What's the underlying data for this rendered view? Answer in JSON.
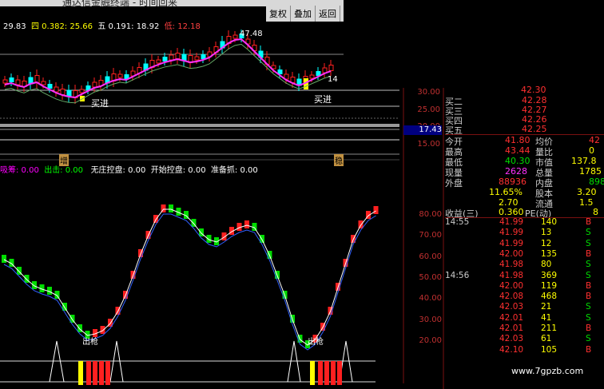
{
  "window": {
    "title": "通达信金融终端 - 时间回来",
    "buttons": [
      "复权",
      "叠加",
      "返回"
    ]
  },
  "price_panel": {
    "legend": [
      {
        "text": "29.83",
        "color": "#ffffff"
      },
      {
        "text": "四 0.382: 25.66",
        "color": "#ffff00"
      },
      {
        "text": "五 0.191: 18.92",
        "color": "#ffffff"
      },
      {
        "text": "低: 12.18",
        "color": "#ff4040"
      }
    ],
    "peak_label": "47.48",
    "low_label": "14",
    "buy_label": "买进",
    "axis": [
      "30.00",
      "25.00",
      "20.00",
      "15.00"
    ],
    "current_price": "17.43",
    "left_marker": "增",
    "right_marker": "稳"
  },
  "indicator_panel": {
    "legend": [
      {
        "text": "吸筹: 0.00",
        "color": "#ff00ff"
      },
      {
        "text": "出击: 0.00",
        "color": "#00ff00"
      },
      {
        "text": "无庄控盘: 0.00",
        "color": "#ffffff"
      },
      {
        "text": "开始控盘: 0.00",
        "color": "#ffffff"
      },
      {
        "text": "准备抓: 0.00",
        "color": "#ffffff"
      }
    ],
    "axis": [
      "80.00",
      "70.00",
      "60.00",
      "50.00",
      "40.00",
      "30.00",
      "20.00"
    ],
    "signal_label": "出枪"
  },
  "quote": {
    "bids": [
      {
        "label": "买二",
        "price": "42.28"
      },
      {
        "label": "买三",
        "price": "42.27"
      },
      {
        "label": "买四",
        "price": "42.26"
      },
      {
        "label": "买五",
        "price": "42.25"
      }
    ],
    "top_price": "42.30",
    "stats": [
      {
        "l1": "今开",
        "v1": "41.80",
        "l2": "均价",
        "v2": "42"
      },
      {
        "l1": "最高",
        "v1": "43.44",
        "l2": "量比",
        "v2": "0"
      },
      {
        "l1": "最低",
        "v1": "40.30",
        "l2": "市值",
        "v2": "137.8"
      },
      {
        "l1": "现量",
        "v1": "2628",
        "l2": "总量",
        "v2": "1785"
      },
      {
        "l1": "外盘",
        "v1": "88936",
        "l2": "内盘",
        "v2": "898"
      }
    ],
    "extra": [
      {
        "v1": "11.65%",
        "l2": "股本",
        "v2": "3.20"
      },
      {
        "v1": "2.70",
        "l2": "流通",
        "v2": "1.5"
      },
      {
        "l1": "收益(三)",
        "v1": "0.360",
        "l2": "PE(动)",
        "v2": "8"
      }
    ]
  },
  "trades": [
    {
      "time": "14:55",
      "price": "41.99",
      "vol": "140",
      "side": "B"
    },
    {
      "time": "",
      "price": "41.99",
      "vol": "13",
      "side": "S"
    },
    {
      "time": "",
      "price": "41.99",
      "vol": "12",
      "side": "S"
    },
    {
      "time": "",
      "price": "42.00",
      "vol": "135",
      "side": "B"
    },
    {
      "time": "",
      "price": "41.98",
      "vol": "80",
      "side": "S"
    },
    {
      "time": "14:56",
      "price": "41.98",
      "vol": "369",
      "side": "S"
    },
    {
      "time": "",
      "price": "42.00",
      "vol": "119",
      "side": "B"
    },
    {
      "time": "",
      "price": "42.08",
      "vol": "468",
      "side": "B"
    },
    {
      "time": "",
      "price": "42.03",
      "vol": "21",
      "side": "S"
    },
    {
      "time": "",
      "price": "42.01",
      "vol": "41",
      "side": "S"
    },
    {
      "time": "",
      "price": "42.01",
      "vol": "211",
      "side": "B"
    },
    {
      "time": "",
      "price": "42.03",
      "vol": "61",
      "side": "S"
    },
    {
      "time": "",
      "price": "42.10",
      "vol": "105",
      "side": "B"
    }
  ],
  "watermark": "www.7gpzb.com",
  "colors": {
    "up": "#ff2020",
    "down": "#00dd00",
    "ma": "#ff30ff",
    "axis": "#c03030"
  }
}
